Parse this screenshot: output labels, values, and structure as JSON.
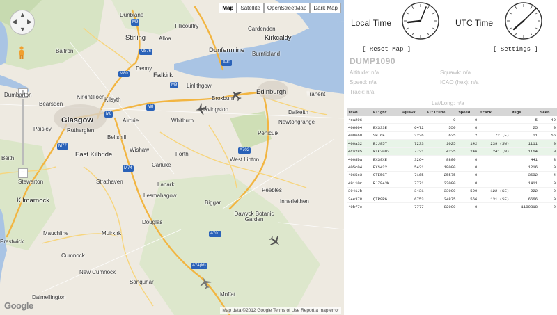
{
  "map": {
    "types": [
      "Map",
      "Satellite",
      "OpenStreetMap",
      "Dark Map"
    ],
    "active_type": "Map",
    "attribution": "Map data ©2012 Google   Terms of Use   Report a map error",
    "logo": "Google",
    "places": [
      {
        "name": "Dunblane",
        "cls": ""
      },
      {
        "name": "Tillicoultry",
        "cls": ""
      },
      {
        "name": "Stirling",
        "cls": "med"
      },
      {
        "name": "Alloa",
        "cls": ""
      },
      {
        "name": "Cardenden",
        "cls": ""
      },
      {
        "name": "Kirkcaldy",
        "cls": "med"
      },
      {
        "name": "Balfron",
        "cls": ""
      },
      {
        "name": "Dunfermline",
        "cls": "med"
      },
      {
        "name": "Burntisland",
        "cls": ""
      },
      {
        "name": "Denny",
        "cls": ""
      },
      {
        "name": "Falkirk",
        "cls": "med"
      },
      {
        "name": "Linlithgow",
        "cls": ""
      },
      {
        "name": "Dumbarton",
        "cls": ""
      },
      {
        "name": "Kilsyth",
        "cls": ""
      },
      {
        "name": "Edinburgh",
        "cls": "med"
      },
      {
        "name": "Bearsden",
        "cls": ""
      },
      {
        "name": "Kirkintilloch",
        "cls": ""
      },
      {
        "name": "Broxburn",
        "cls": ""
      },
      {
        "name": "Tranent",
        "cls": ""
      },
      {
        "name": "Glasgow",
        "cls": "big"
      },
      {
        "name": "Airdrie",
        "cls": ""
      },
      {
        "name": "Livingston",
        "cls": ""
      },
      {
        "name": "Dalkeith",
        "cls": ""
      },
      {
        "name": "Paisley",
        "cls": ""
      },
      {
        "name": "Rutherglen",
        "cls": ""
      },
      {
        "name": "Newtongrange",
        "cls": ""
      },
      {
        "name": "Whitburn",
        "cls": ""
      },
      {
        "name": "Bellshill",
        "cls": ""
      },
      {
        "name": "Penicuik",
        "cls": ""
      },
      {
        "name": "East Kilbride",
        "cls": "med"
      },
      {
        "name": "Wishaw",
        "cls": ""
      },
      {
        "name": "Forth",
        "cls": ""
      },
      {
        "name": "Beith",
        "cls": ""
      },
      {
        "name": "Carluke",
        "cls": ""
      },
      {
        "name": "West Linton",
        "cls": ""
      },
      {
        "name": "Stewarton",
        "cls": ""
      },
      {
        "name": "Strathaven",
        "cls": ""
      },
      {
        "name": "Lanark",
        "cls": ""
      },
      {
        "name": "Peebles",
        "cls": ""
      },
      {
        "name": "Kilmarnock",
        "cls": "med"
      },
      {
        "name": "Lesmahagow",
        "cls": ""
      },
      {
        "name": "Innerleithen",
        "cls": ""
      },
      {
        "name": "Biggar",
        "cls": ""
      },
      {
        "name": "Dawyck Botanic Garden",
        "cls": ""
      },
      {
        "name": "Mauchline",
        "cls": ""
      },
      {
        "name": "Muirkirk",
        "cls": ""
      },
      {
        "name": "Douglas",
        "cls": ""
      },
      {
        "name": "Prestwick",
        "cls": ""
      },
      {
        "name": "Cumnock",
        "cls": ""
      },
      {
        "name": "New Cumnock",
        "cls": ""
      },
      {
        "name": "Sanquhar",
        "cls": ""
      },
      {
        "name": "Dalmellington",
        "cls": ""
      },
      {
        "name": "Moffat",
        "cls": ""
      }
    ],
    "road_badges": [
      "M9",
      "M80",
      "M876",
      "A90",
      "M9",
      "M8",
      "M8",
      "M74",
      "M77",
      "A702",
      "A701",
      "A74(M)"
    ]
  },
  "sidebar": {
    "local_time_label": "Local Time",
    "utc_time_label": "UTC Time",
    "reset_map": "[ Reset Map ]",
    "settings": "[ Settings ]",
    "aircraft_title": "DUMP1090",
    "altitude": "Altitude: n/a",
    "squawk": "Squawk: n/a",
    "speed": "Speed: n/a",
    "icao": "ICAO (hex): n/a",
    "track": "Track: n/a",
    "latlong": "Lat/Long: n/a"
  },
  "table": {
    "headers": [
      "ICAO",
      "Flight",
      "Squawk",
      "Altitude",
      "Speed",
      "Track",
      "Msgs",
      "Seen"
    ],
    "rows": [
      [
        "4ca296",
        "",
        "",
        "0",
        "0",
        "",
        "5",
        "49"
      ],
      [
        "406604",
        "EXS33E",
        "6472",
        "550",
        "0",
        "",
        "25",
        "0"
      ],
      [
        "400660",
        "SHT6F",
        "2226",
        "625",
        "2",
        "72 (E)",
        "11",
        "56"
      ],
      [
        "400a32",
        "EJJ85T",
        "7233",
        "1025",
        "142",
        "239 (SW)",
        "1111",
        "0"
      ],
      [
        "4ca285",
        "WTK3002",
        "7721",
        "4225",
        "246",
        "241 (W)",
        "1164",
        "0"
      ],
      [
        "4008ba",
        "EXS9XE",
        "3264",
        "8800",
        "0",
        "",
        "441",
        "3"
      ],
      [
        "405c04",
        "EXS422",
        "5431",
        "18000",
        "0",
        "",
        "1216",
        "0"
      ],
      [
        "4065c3",
        "CTE5GT",
        "7165",
        "25575",
        "0",
        "",
        "3592",
        "4"
      ],
      [
        "49110c",
        "RJZ843K",
        "7771",
        "32000",
        "0",
        "",
        "1411",
        "0"
      ],
      [
        "3941Jb",
        "",
        "3431",
        "33000",
        "599",
        "122 (SE)",
        "222",
        "0"
      ],
      [
        "34e378",
        "QTR9RG",
        "6753",
        "34875",
        "566",
        "131 (SE)",
        "6666",
        "0"
      ],
      [
        "40bf7e",
        "",
        "7777",
        "82000",
        "0",
        "",
        "1109818",
        "2"
      ]
    ]
  }
}
